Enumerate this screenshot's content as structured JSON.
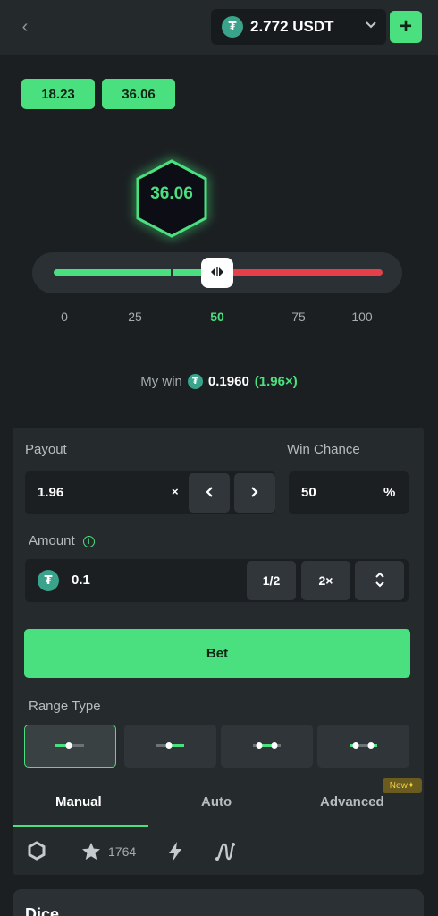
{
  "header": {
    "back_icon": "chevron-left-icon",
    "balance": "2.772 USDT",
    "currency_icon": "usdt-icon",
    "currency_glyph": "₮",
    "add_label": "+"
  },
  "history": [
    "18.23",
    "36.06"
  ],
  "result": {
    "value": "36.06"
  },
  "slider": {
    "position_percent": 50,
    "scale": [
      "0",
      "25",
      "50",
      "75",
      "100"
    ],
    "active_scale": "50"
  },
  "my_win": {
    "label": "My win",
    "amount": "0.1960",
    "multiplier": "(1.96×)"
  },
  "payout": {
    "label": "Payout",
    "value": "1.96",
    "suffix": "×",
    "dec_label": "‹",
    "inc_label": "›"
  },
  "win_chance": {
    "label": "Win Chance",
    "value": "50",
    "suffix": "%"
  },
  "amount": {
    "label": "Amount",
    "value": "0.1",
    "half_label": "1/2",
    "double_label": "2×",
    "range_label": "⇕"
  },
  "bet_button": "Bet",
  "range_type": {
    "label": "Range Type",
    "selected_index": 0
  },
  "tabs": [
    {
      "label": "Manual",
      "active": true
    },
    {
      "label": "Auto",
      "active": false
    },
    {
      "label": "Advanced",
      "active": false
    }
  ],
  "new_badge": "New✦",
  "toolbar": {
    "favorites_count": "1764"
  },
  "bottom": {
    "title": "Dice"
  },
  "colors": {
    "accent": "#4be07f",
    "danger": "#e5404a",
    "background": "#1b1f21",
    "panel": "#252a2c"
  }
}
